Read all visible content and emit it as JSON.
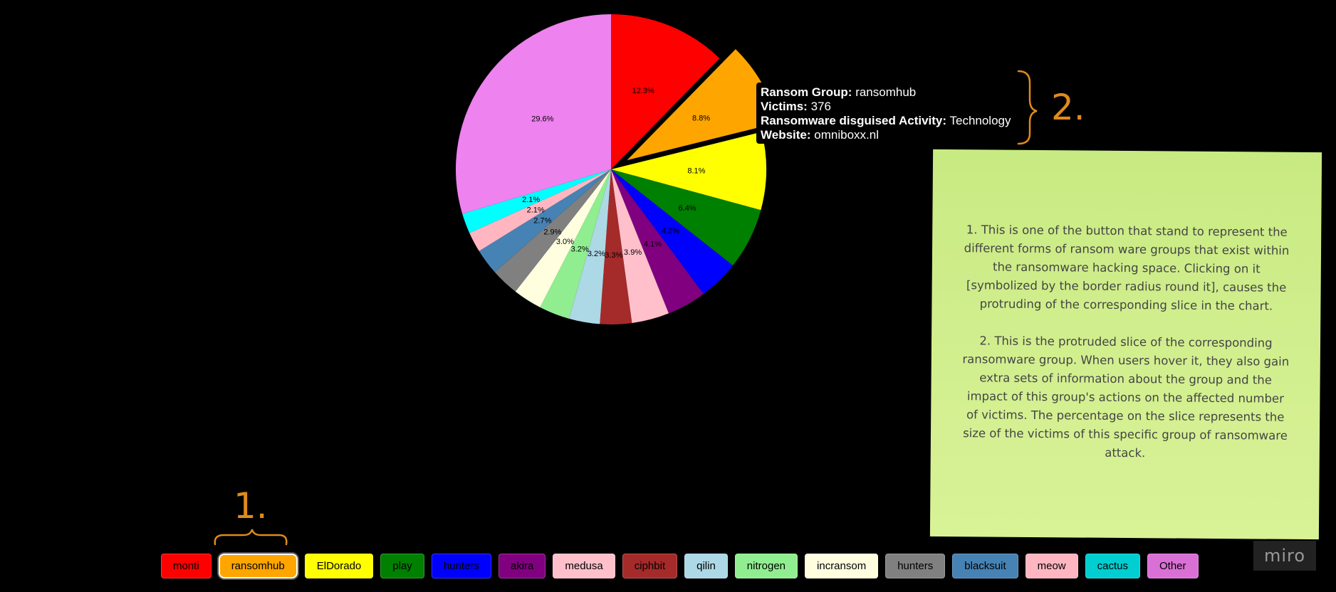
{
  "chart_data": {
    "type": "pie",
    "highlighted": "ransomhub",
    "slices": [
      {
        "name": "monti",
        "value": 12.3,
        "label": "12.3%",
        "color": "#ff0000"
      },
      {
        "name": "ransomhub",
        "value": 8.8,
        "label": "8.8%",
        "color": "#ffa500"
      },
      {
        "name": "ElDorado",
        "value": 8.1,
        "label": "8.1%",
        "color": "#ffff00"
      },
      {
        "name": "play",
        "value": 6.4,
        "label": "6.4%",
        "color": "#008000"
      },
      {
        "name": "hunters",
        "value": 4.2,
        "label": "4.2%",
        "color": "#0000ff"
      },
      {
        "name": "akira",
        "value": 4.1,
        "label": "4.1%",
        "color": "#800080"
      },
      {
        "name": "medusa",
        "value": 3.9,
        "label": "3.9%",
        "color": "#ffc0cb"
      },
      {
        "name": "ciphbit",
        "value": 3.3,
        "label": "3.3%",
        "color": "#a52a2a"
      },
      {
        "name": "qilin",
        "value": 3.2,
        "label": "3.2%",
        "color": "#add8e6"
      },
      {
        "name": "nitrogen",
        "value": 3.2,
        "label": "3.2%",
        "color": "#90ee90"
      },
      {
        "name": "incransom",
        "value": 3.0,
        "label": "3.0%",
        "color": "#ffffe0"
      },
      {
        "name": "hunters",
        "value": 2.9,
        "label": "2.9%",
        "color": "#808080"
      },
      {
        "name": "blacksuit",
        "value": 2.7,
        "label": "2.7%",
        "color": "#4682b4"
      },
      {
        "name": "meow",
        "value": 2.1,
        "label": "2.1%",
        "color": "#ffb6c1"
      },
      {
        "name": "cactus",
        "value": 2.1,
        "label": "2.1%",
        "color": "#00ffff"
      },
      {
        "name": "Other",
        "value": 29.6,
        "label": "29.6%",
        "color": "#ee82ee"
      }
    ]
  },
  "tooltip": {
    "group_label": "Ransom Group:",
    "group_value": "ransomhub",
    "victims_label": "Victims:",
    "victims_value": "376",
    "activity_label": "Ransomware disguised Activity:",
    "activity_value": "Technology",
    "website_label": "Website:",
    "website_value": "omniboxx.nl"
  },
  "legend": [
    {
      "label": "monti",
      "color": "#ff0000"
    },
    {
      "label": "ransomhub",
      "color": "#ffa500",
      "active": true
    },
    {
      "label": "ElDorado",
      "color": "#ffff00"
    },
    {
      "label": "play",
      "color": "#008000"
    },
    {
      "label": "hunters",
      "color": "#0000ff"
    },
    {
      "label": "akira",
      "color": "#800080"
    },
    {
      "label": "medusa",
      "color": "#ffc0cb"
    },
    {
      "label": "ciphbit",
      "color": "#a52a2a"
    },
    {
      "label": "qilin",
      "color": "#add8e6"
    },
    {
      "label": "nitrogen",
      "color": "#90ee90"
    },
    {
      "label": "incransom",
      "color": "#ffffe0"
    },
    {
      "label": "hunters",
      "color": "#808080"
    },
    {
      "label": "blacksuit",
      "color": "#4682b4"
    },
    {
      "label": "meow",
      "color": "#ffb6c1"
    },
    {
      "label": "cactus",
      "color": "#00ced1"
    },
    {
      "label": "Other",
      "color": "#da70d6"
    }
  ],
  "annotations": {
    "one": "1.",
    "two": "2.",
    "color": "#e08a1c"
  },
  "note": {
    "paragraph1": "1. This is one of the button that stand to represent the different forms of ransom ware groups that exist within the ransomware hacking space. Clicking on it [symbolized by the border radius round it], causes the protruding of the corresponding slice in the chart.",
    "paragraph2": "2.  This is the protruded slice of the corresponding ransomware group. When users hover it, they also gain extra sets of information about the group and the impact of this group's actions on the affected number of victims. The percentage on the slice represents the size of the victims of this specific group of ransomware attack."
  },
  "branding": {
    "logo_text": "miro"
  }
}
